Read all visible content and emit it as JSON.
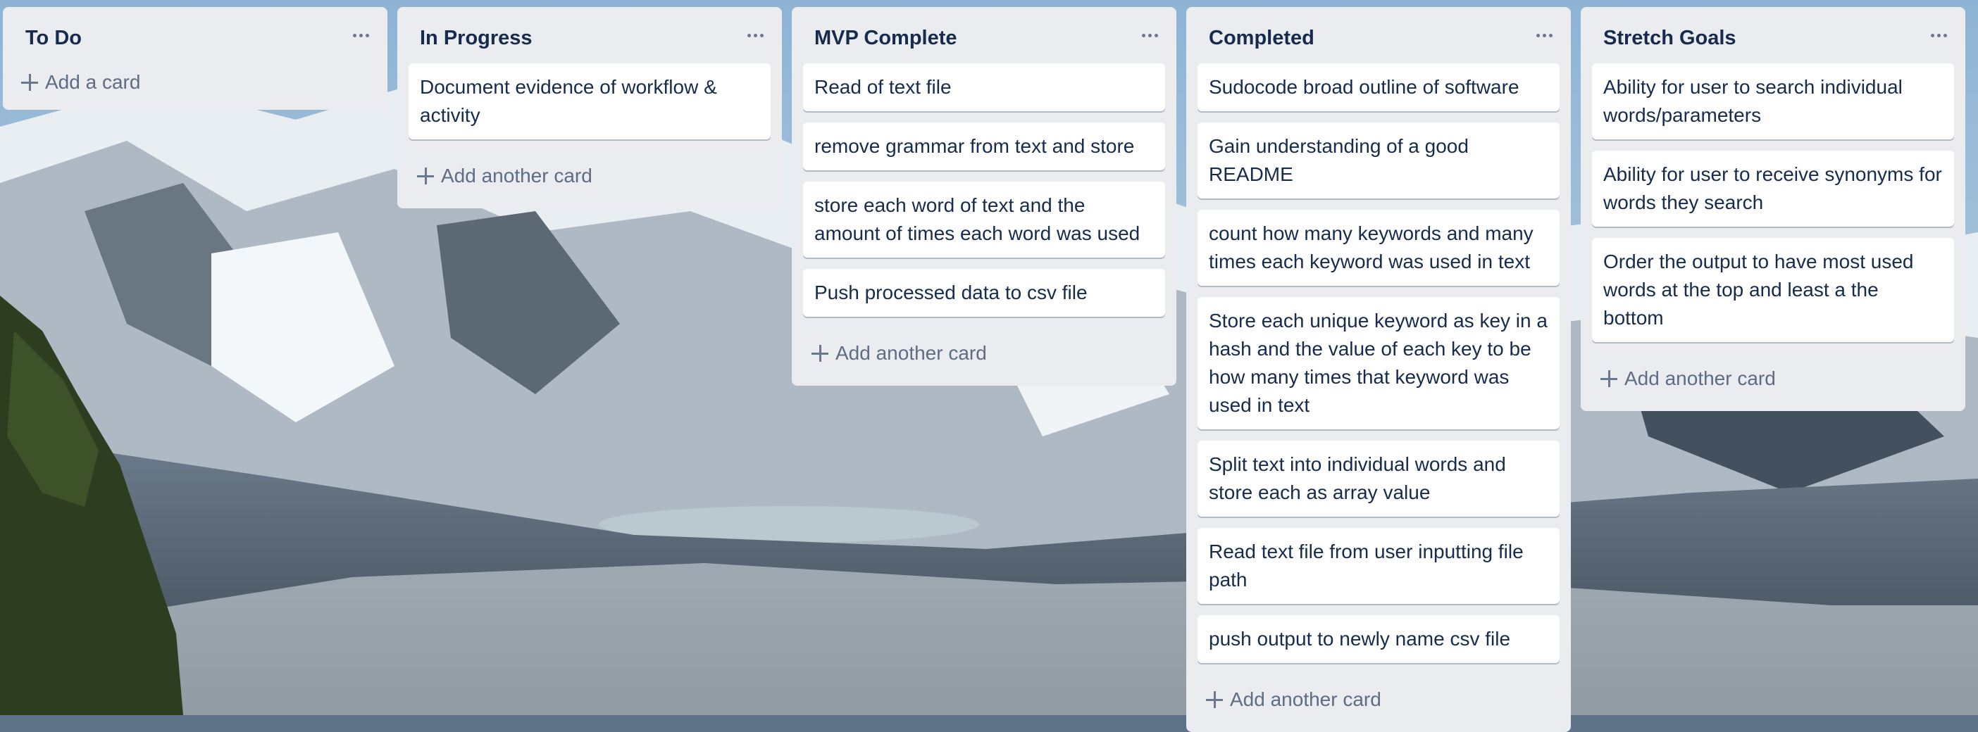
{
  "board": {
    "lists": [
      {
        "title": "To Do",
        "menu_icon": "more-horizontal-icon",
        "cards": [],
        "add_label": "Add a card"
      },
      {
        "title": "In Progress",
        "menu_icon": "more-horizontal-icon",
        "cards": [
          "Document evidence of workflow & activity"
        ],
        "add_label": "Add another card"
      },
      {
        "title": "MVP Complete",
        "menu_icon": "more-horizontal-icon",
        "cards": [
          "Read of text file",
          "remove grammar from text and store",
          "store each word of text and the amount of times each word was used",
          "Push processed data to csv file"
        ],
        "add_label": "Add another card"
      },
      {
        "title": "Completed",
        "menu_icon": "more-horizontal-icon",
        "cards": [
          "Sudocode broad outline of software",
          "Gain understanding of a good README",
          "count how many keywords and many times each keyword was used in text",
          "Store each unique keyword as key in a hash and the value of each key to be how many times that keyword was used in text",
          "Split text into individual words and store each as array value",
          "Read text file from user inputting file path",
          "push output to newly name csv file"
        ],
        "add_label": "Add another card"
      },
      {
        "title": "Stretch Goals",
        "menu_icon": "more-horizontal-icon",
        "cards": [
          "Ability for user to search individual words/parameters",
          "Ability for user to receive synonyms for words they search",
          "Order the output to have most used words at the top and least a the bottom"
        ],
        "add_label": "Add another card"
      }
    ]
  },
  "colors": {
    "list_bg": "#ebecf0",
    "card_bg": "#ffffff",
    "title_text": "#172b4d",
    "muted_text": "#5e6c84"
  }
}
